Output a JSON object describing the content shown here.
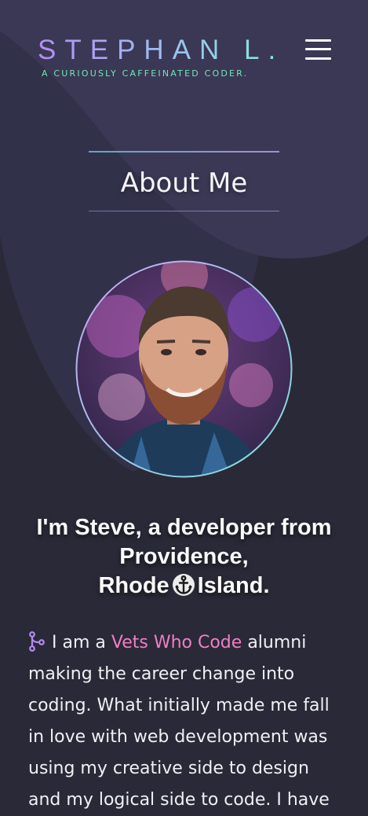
{
  "header": {
    "brand_name": "STEPHAN L.",
    "tagline": "A CURIOUSLY CAFFEINATED CODER.",
    "menu_icon": "hamburger-menu-icon"
  },
  "about": {
    "section_title": "About Me",
    "intro_line1": "I'm Steve, a developer from",
    "intro_line2": "Providence,",
    "intro_city_word": "Rhode",
    "intro_state_word": "Island.",
    "intro_icon": "anchor-icon",
    "bio_icon": "git-branch-icon",
    "bio_before_link": "I am a",
    "bio_link": "Vets Who Code",
    "bio_after_link": "alumni making the career change into coding. What initially made me fall in love with web development was using my creative side to design and my logical side to code. I have"
  },
  "colors": {
    "background": "#2a2937",
    "hero_blob": "#3a3854",
    "brand_gradient_start": "#b48cf2",
    "brand_gradient_end": "#8ee6d9",
    "tagline": "#73e6b9",
    "link": "#ef7fc7"
  }
}
